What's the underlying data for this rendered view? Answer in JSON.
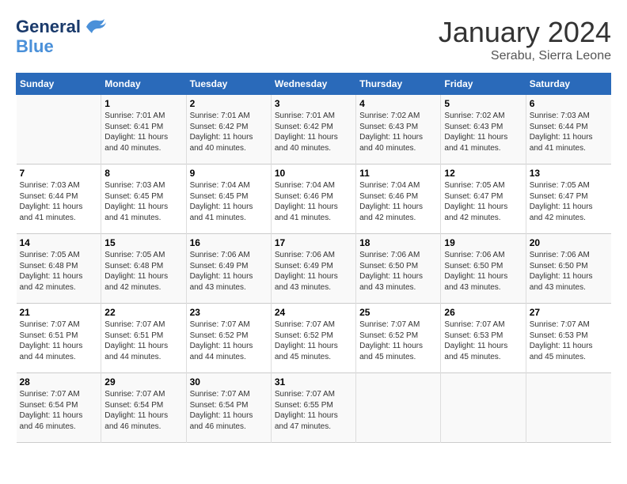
{
  "header": {
    "logo_general": "General",
    "logo_blue": "Blue",
    "month": "January 2024",
    "location": "Serabu, Sierra Leone"
  },
  "days_of_week": [
    "Sunday",
    "Monday",
    "Tuesday",
    "Wednesday",
    "Thursday",
    "Friday",
    "Saturday"
  ],
  "weeks": [
    [
      {
        "day": "",
        "info": ""
      },
      {
        "day": "1",
        "info": "Sunrise: 7:01 AM\nSunset: 6:41 PM\nDaylight: 11 hours\nand 40 minutes."
      },
      {
        "day": "2",
        "info": "Sunrise: 7:01 AM\nSunset: 6:42 PM\nDaylight: 11 hours\nand 40 minutes."
      },
      {
        "day": "3",
        "info": "Sunrise: 7:01 AM\nSunset: 6:42 PM\nDaylight: 11 hours\nand 40 minutes."
      },
      {
        "day": "4",
        "info": "Sunrise: 7:02 AM\nSunset: 6:43 PM\nDaylight: 11 hours\nand 40 minutes."
      },
      {
        "day": "5",
        "info": "Sunrise: 7:02 AM\nSunset: 6:43 PM\nDaylight: 11 hours\nand 41 minutes."
      },
      {
        "day": "6",
        "info": "Sunrise: 7:03 AM\nSunset: 6:44 PM\nDaylight: 11 hours\nand 41 minutes."
      }
    ],
    [
      {
        "day": "7",
        "info": "Sunrise: 7:03 AM\nSunset: 6:44 PM\nDaylight: 11 hours\nand 41 minutes."
      },
      {
        "day": "8",
        "info": "Sunrise: 7:03 AM\nSunset: 6:45 PM\nDaylight: 11 hours\nand 41 minutes."
      },
      {
        "day": "9",
        "info": "Sunrise: 7:04 AM\nSunset: 6:45 PM\nDaylight: 11 hours\nand 41 minutes."
      },
      {
        "day": "10",
        "info": "Sunrise: 7:04 AM\nSunset: 6:46 PM\nDaylight: 11 hours\nand 41 minutes."
      },
      {
        "day": "11",
        "info": "Sunrise: 7:04 AM\nSunset: 6:46 PM\nDaylight: 11 hours\nand 42 minutes."
      },
      {
        "day": "12",
        "info": "Sunrise: 7:05 AM\nSunset: 6:47 PM\nDaylight: 11 hours\nand 42 minutes."
      },
      {
        "day": "13",
        "info": "Sunrise: 7:05 AM\nSunset: 6:47 PM\nDaylight: 11 hours\nand 42 minutes."
      }
    ],
    [
      {
        "day": "14",
        "info": "Sunrise: 7:05 AM\nSunset: 6:48 PM\nDaylight: 11 hours\nand 42 minutes."
      },
      {
        "day": "15",
        "info": "Sunrise: 7:05 AM\nSunset: 6:48 PM\nDaylight: 11 hours\nand 42 minutes."
      },
      {
        "day": "16",
        "info": "Sunrise: 7:06 AM\nSunset: 6:49 PM\nDaylight: 11 hours\nand 43 minutes."
      },
      {
        "day": "17",
        "info": "Sunrise: 7:06 AM\nSunset: 6:49 PM\nDaylight: 11 hours\nand 43 minutes."
      },
      {
        "day": "18",
        "info": "Sunrise: 7:06 AM\nSunset: 6:50 PM\nDaylight: 11 hours\nand 43 minutes."
      },
      {
        "day": "19",
        "info": "Sunrise: 7:06 AM\nSunset: 6:50 PM\nDaylight: 11 hours\nand 43 minutes."
      },
      {
        "day": "20",
        "info": "Sunrise: 7:06 AM\nSunset: 6:50 PM\nDaylight: 11 hours\nand 43 minutes."
      }
    ],
    [
      {
        "day": "21",
        "info": "Sunrise: 7:07 AM\nSunset: 6:51 PM\nDaylight: 11 hours\nand 44 minutes."
      },
      {
        "day": "22",
        "info": "Sunrise: 7:07 AM\nSunset: 6:51 PM\nDaylight: 11 hours\nand 44 minutes."
      },
      {
        "day": "23",
        "info": "Sunrise: 7:07 AM\nSunset: 6:52 PM\nDaylight: 11 hours\nand 44 minutes."
      },
      {
        "day": "24",
        "info": "Sunrise: 7:07 AM\nSunset: 6:52 PM\nDaylight: 11 hours\nand 45 minutes."
      },
      {
        "day": "25",
        "info": "Sunrise: 7:07 AM\nSunset: 6:52 PM\nDaylight: 11 hours\nand 45 minutes."
      },
      {
        "day": "26",
        "info": "Sunrise: 7:07 AM\nSunset: 6:53 PM\nDaylight: 11 hours\nand 45 minutes."
      },
      {
        "day": "27",
        "info": "Sunrise: 7:07 AM\nSunset: 6:53 PM\nDaylight: 11 hours\nand 45 minutes."
      }
    ],
    [
      {
        "day": "28",
        "info": "Sunrise: 7:07 AM\nSunset: 6:54 PM\nDaylight: 11 hours\nand 46 minutes."
      },
      {
        "day": "29",
        "info": "Sunrise: 7:07 AM\nSunset: 6:54 PM\nDaylight: 11 hours\nand 46 minutes."
      },
      {
        "day": "30",
        "info": "Sunrise: 7:07 AM\nSunset: 6:54 PM\nDaylight: 11 hours\nand 46 minutes."
      },
      {
        "day": "31",
        "info": "Sunrise: 7:07 AM\nSunset: 6:55 PM\nDaylight: 11 hours\nand 47 minutes."
      },
      {
        "day": "",
        "info": ""
      },
      {
        "day": "",
        "info": ""
      },
      {
        "day": "",
        "info": ""
      }
    ]
  ]
}
